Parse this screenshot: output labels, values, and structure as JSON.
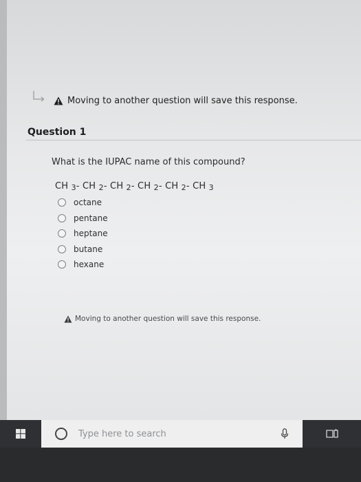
{
  "notice": {
    "top_text": "Moving to another question will save this response.",
    "bottom_text": "Moving to another question will save this response."
  },
  "question": {
    "header": "Question 1",
    "prompt": "What is the IUPAC name of this compound?",
    "formula_parts": [
      "CH ",
      "3",
      "- CH ",
      "2",
      "- CH ",
      "2",
      "- CH ",
      "2",
      "- CH ",
      "2",
      "- CH ",
      "3"
    ],
    "options": [
      "octane",
      "pentane",
      "heptane",
      "butane",
      "hexane"
    ]
  },
  "taskbar": {
    "search_placeholder": "Type here to search"
  },
  "icons": {
    "start": "windows-start-icon",
    "search": "cortana-circle-icon",
    "mic": "microphone-icon",
    "task_view": "task-view-icon",
    "warning": "warning-triangle-icon",
    "nav": "back-arrow-icon"
  }
}
